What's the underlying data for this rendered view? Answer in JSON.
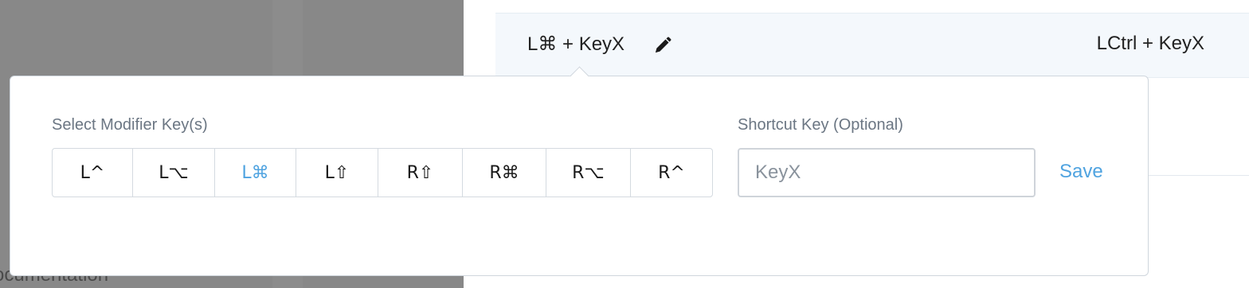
{
  "sidebar": {
    "doc_label": "ocumentation"
  },
  "shortcut_row": {
    "current": "L⌘ + KeyX",
    "default": "LCtrl + KeyX",
    "edit_icon": "pencil-icon"
  },
  "popover": {
    "modifier_label": "Select Modifier Key(s)",
    "modifiers": [
      {
        "label": "L^",
        "selected": false
      },
      {
        "label": "L⌥",
        "selected": false
      },
      {
        "label": "L⌘",
        "selected": true
      },
      {
        "label": "L⇧",
        "selected": false
      },
      {
        "label": "R⇧",
        "selected": false
      },
      {
        "label": "R⌘",
        "selected": false
      },
      {
        "label": "R⌥",
        "selected": false
      },
      {
        "label": "R^",
        "selected": false
      }
    ],
    "shortcut_label": "Shortcut Key (Optional)",
    "shortcut_placeholder": "KeyX",
    "save_label": "Save"
  },
  "colors": {
    "accent": "#4fa3e0",
    "overlay": "#888888"
  }
}
